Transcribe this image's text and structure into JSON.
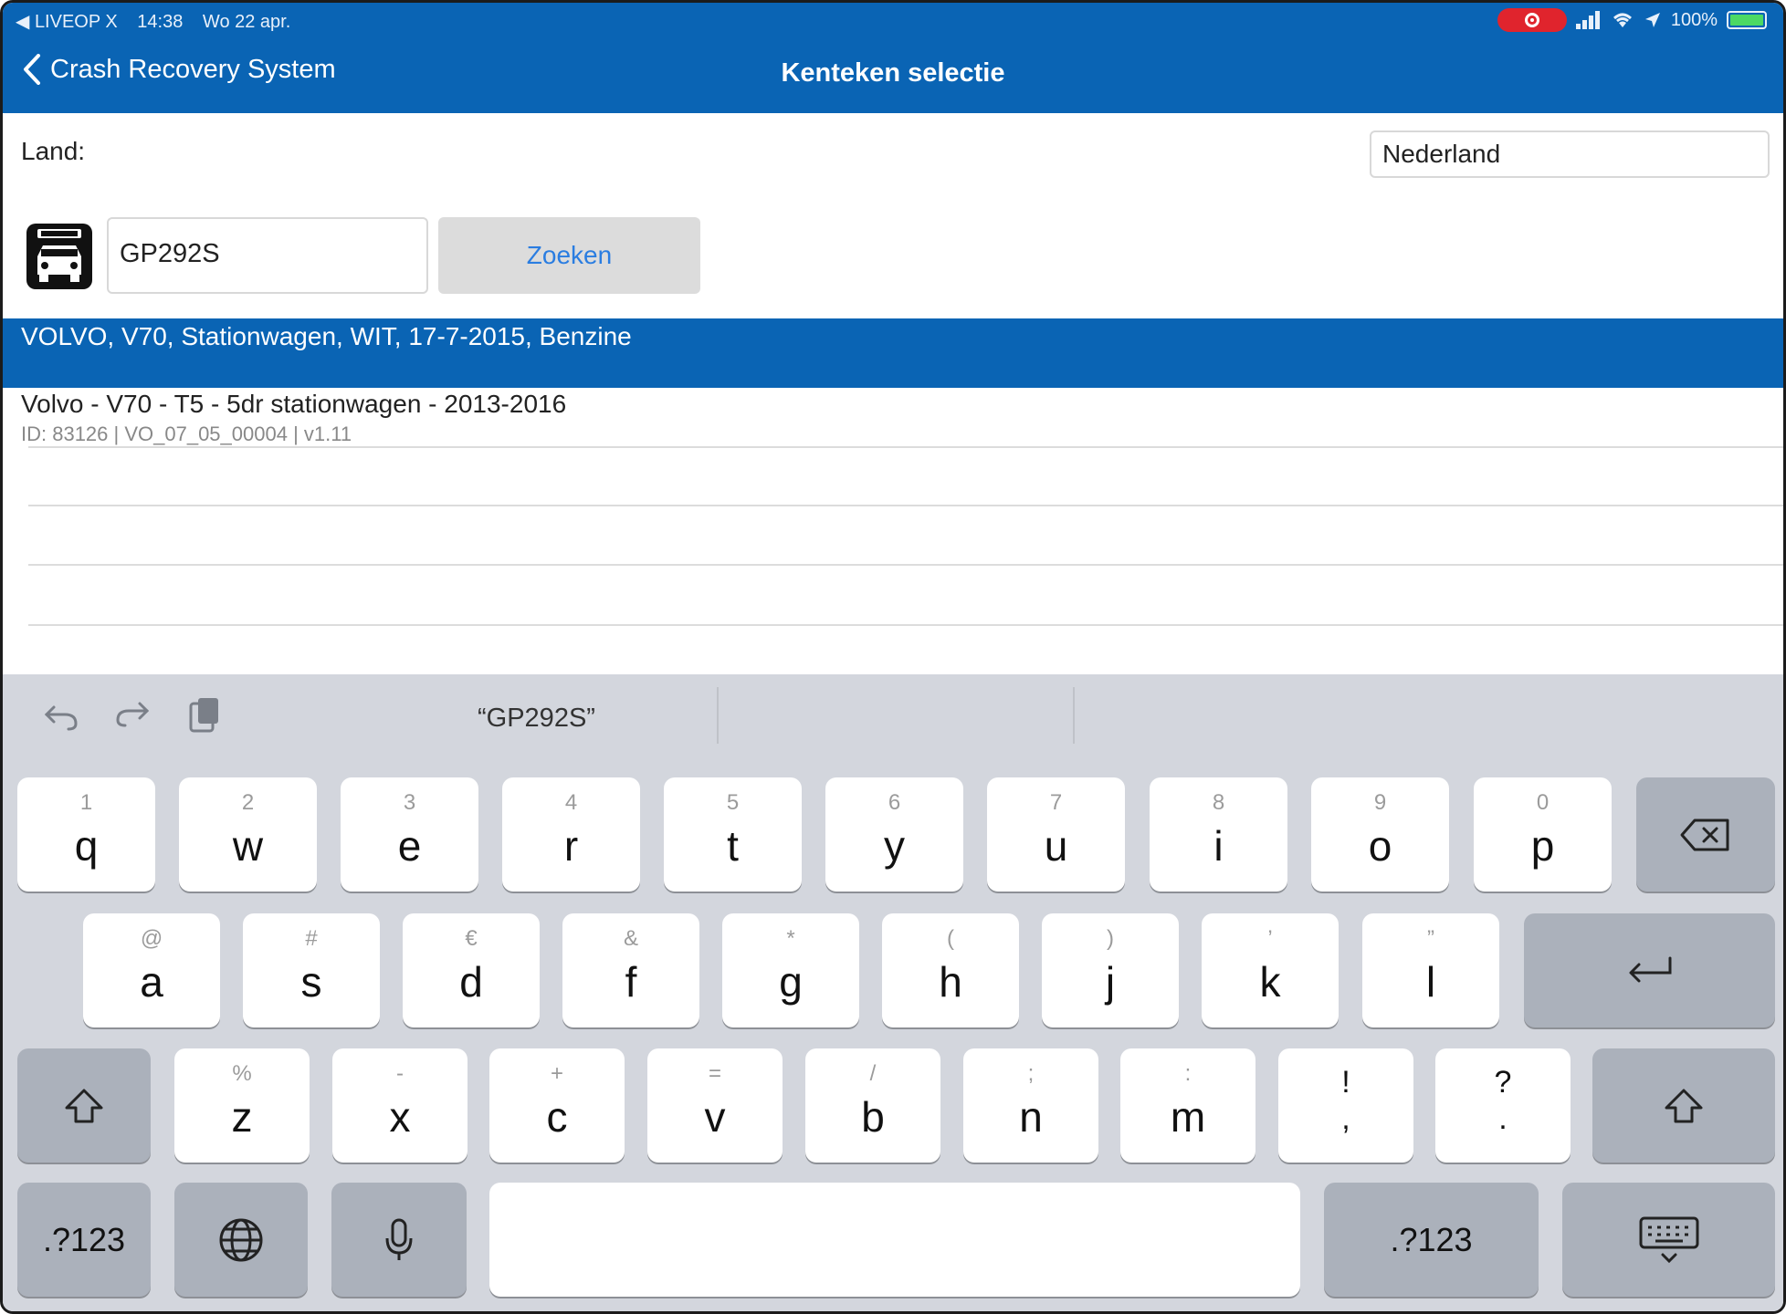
{
  "status_bar": {
    "carrier": "◀ LIVEOP X",
    "time": "14:38",
    "date": "Wo 22 apr.",
    "battery": "100%"
  },
  "nav": {
    "back_label": "Crash Recovery System",
    "title": "Kenteken selectie"
  },
  "form": {
    "land_label": "Land:",
    "land_value": "Nederland",
    "plate_value": "GP292S",
    "search_label": "Zoeken"
  },
  "results": {
    "selected": "VOLVO, V70, Stationwagen, WIT, 17-7-2015, Benzine",
    "items": [
      {
        "title": "Volvo - V70 - T5 - 5dr stationwagen - 2013-2016",
        "subtitle": "ID: 83126 | VO_07_05_00004 | v1.11"
      }
    ]
  },
  "keyboard": {
    "suggestion": "“GP292S”",
    "row1": [
      {
        "hint": "1",
        "key": "q"
      },
      {
        "hint": "2",
        "key": "w"
      },
      {
        "hint": "3",
        "key": "e"
      },
      {
        "hint": "4",
        "key": "r"
      },
      {
        "hint": "5",
        "key": "t"
      },
      {
        "hint": "6",
        "key": "y"
      },
      {
        "hint": "7",
        "key": "u"
      },
      {
        "hint": "8",
        "key": "i"
      },
      {
        "hint": "9",
        "key": "o"
      },
      {
        "hint": "0",
        "key": "p"
      }
    ],
    "row2": [
      {
        "hint": "@",
        "key": "a"
      },
      {
        "hint": "#",
        "key": "s"
      },
      {
        "hint": "€",
        "key": "d"
      },
      {
        "hint": "&",
        "key": "f"
      },
      {
        "hint": "*",
        "key": "g"
      },
      {
        "hint": "(",
        "key": "h"
      },
      {
        "hint": ")",
        "key": "j"
      },
      {
        "hint": "’",
        "key": "k"
      },
      {
        "hint": "”",
        "key": "l"
      }
    ],
    "row3": [
      {
        "hint": "%",
        "key": "z"
      },
      {
        "hint": "-",
        "key": "x"
      },
      {
        "hint": "+",
        "key": "c"
      },
      {
        "hint": "=",
        "key": "v"
      },
      {
        "hint": "/",
        "key": "b"
      },
      {
        "hint": ";",
        "key": "n"
      },
      {
        "hint": ":",
        "key": "m"
      }
    ],
    "row3_punct": [
      {
        "top": "!",
        "bottom": ","
      },
      {
        "top": "?",
        "bottom": "."
      }
    ],
    "numbers_label": ".?123"
  }
}
